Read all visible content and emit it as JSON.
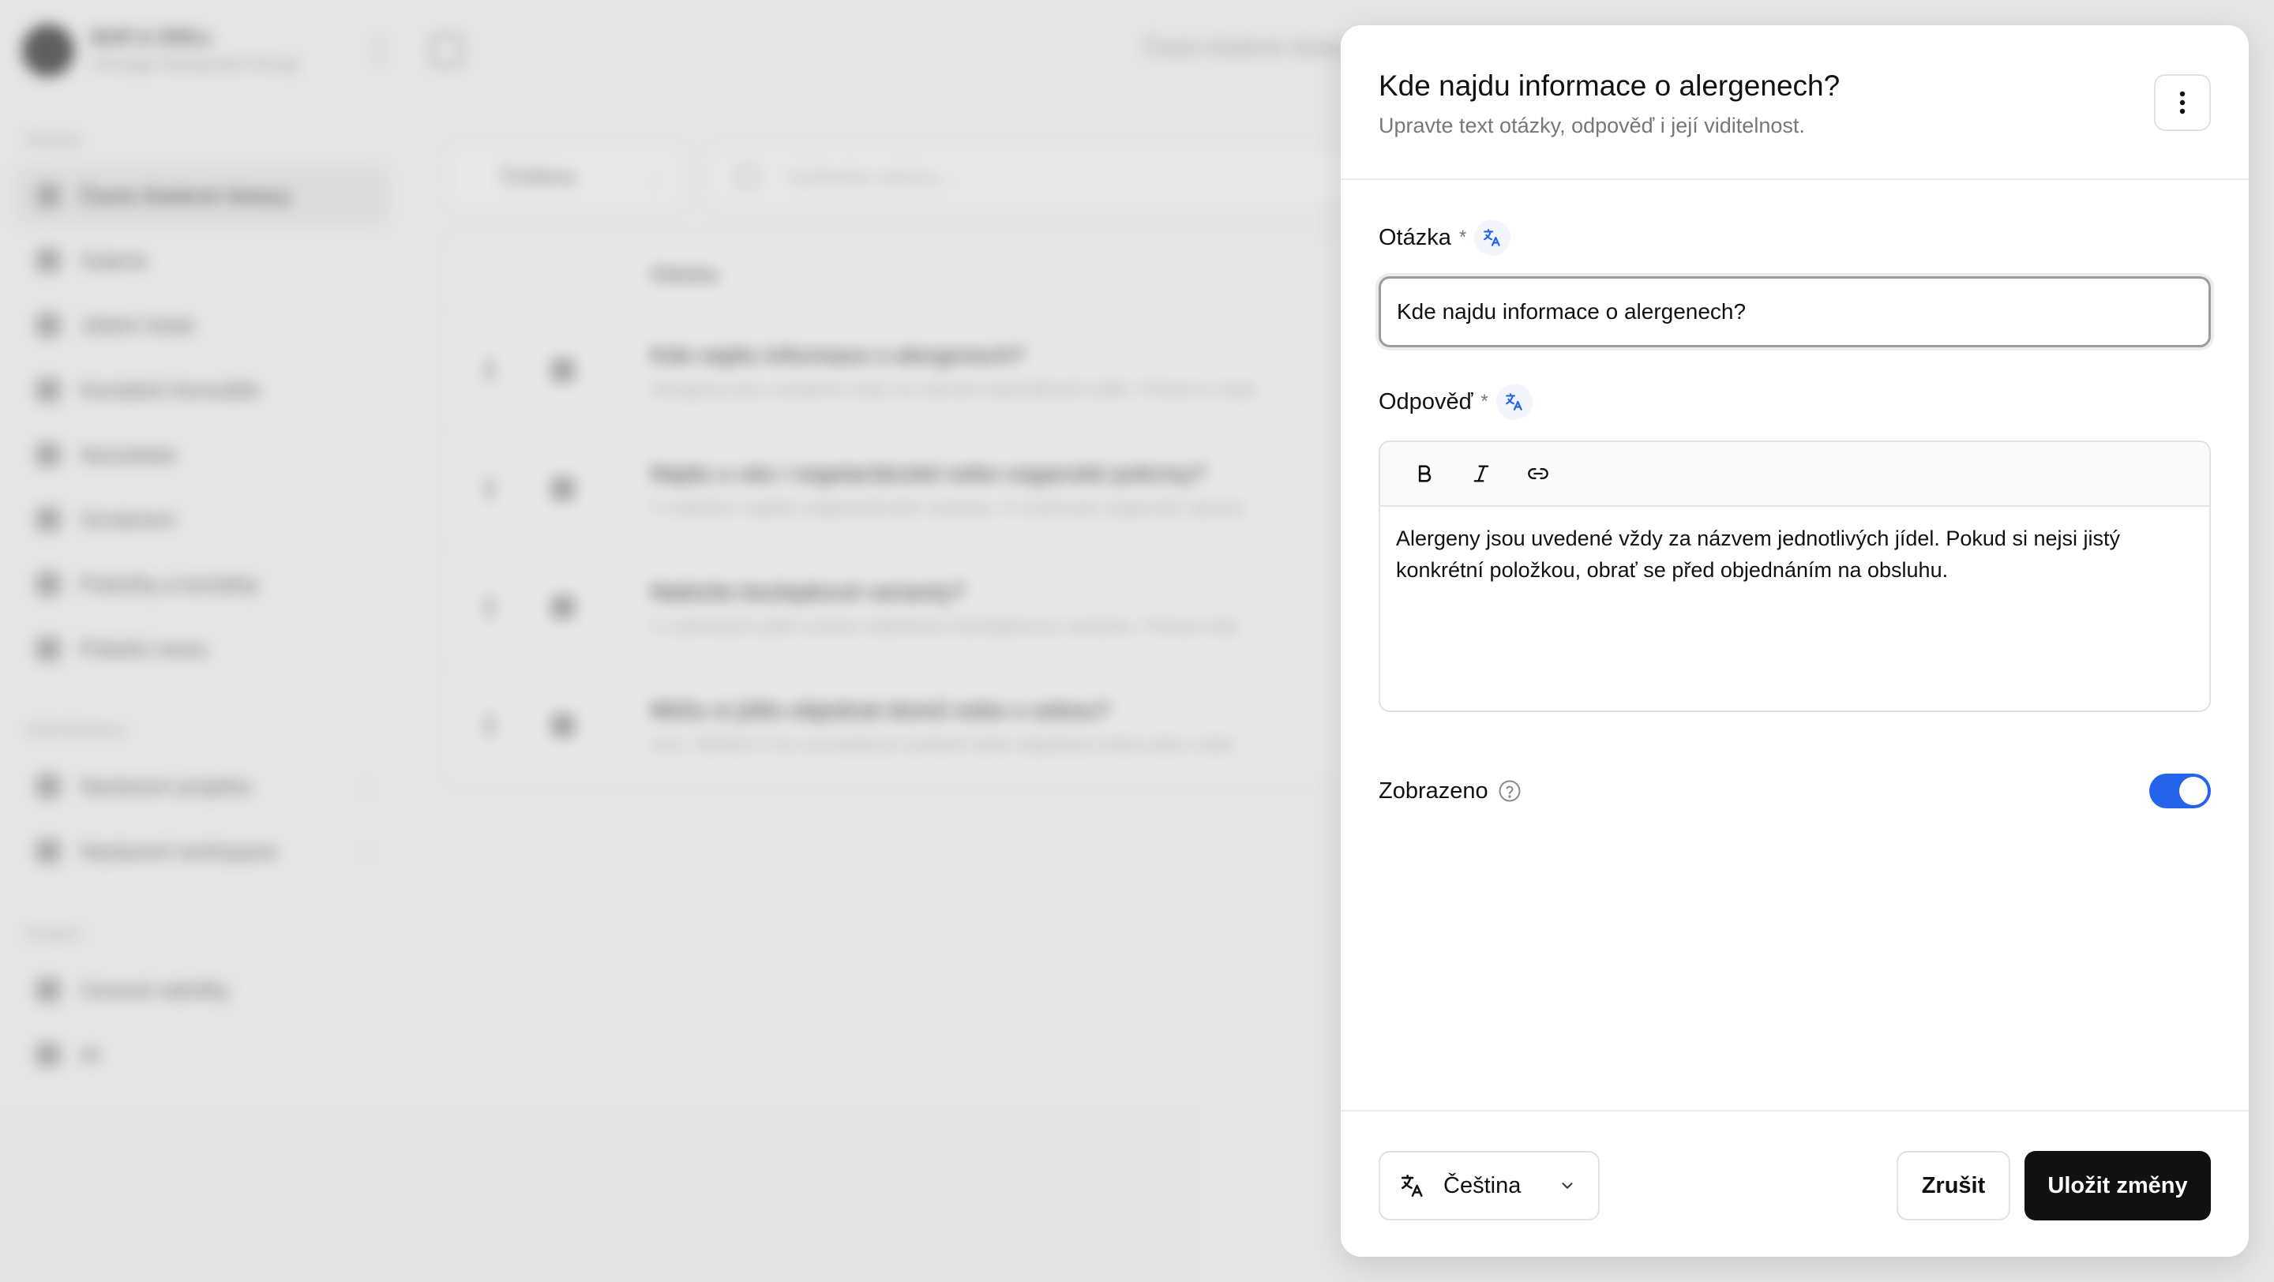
{
  "background": {
    "workspace": {
      "name": "BAR & GRILL",
      "subtitle": "Chicago Restaurant Group"
    },
    "sections": {
      "module": "Moduly",
      "admin": "Administrace",
      "other": "Ostatní"
    },
    "sidebar_items": [
      {
        "label": "Často kladené dotazy"
      },
      {
        "label": "Galerie"
      },
      {
        "label": "Jídelní lístek"
      },
      {
        "label": "Kontaktní formuláře"
      },
      {
        "label": "Newsletter"
      },
      {
        "label": "Oznámení"
      },
      {
        "label": "Pobočky a kontakty"
      },
      {
        "label": "Polední menu"
      },
      {
        "label": "Nastavení projektu"
      },
      {
        "label": "Nastavení workspace"
      },
      {
        "label": "Cenové nabídky"
      },
      {
        "label": "AI"
      }
    ],
    "page_title": "Často kladené dotazy",
    "filter_language": "Čeština",
    "search_placeholder": "Vyhledat otázku...",
    "table_header": "Otázka",
    "rows": [
      {
        "question": "Kde najdu informace o alergenech?",
        "answer": "Alergeny jsou uvedené vždy za názvem jednotlivých jídel. Pokud si nejsi"
      },
      {
        "question": "Najdu u vás i vegetariánské nebo veganské pokrmy?",
        "answer": "V nabídce najdeš vegetariánské varianty. O možnosti veganské úpravy"
      },
      {
        "question": "Nabízíte bezlepkové varianty?",
        "answer": "U vybraných jídel umíme nabídnout bezlepkovou variantu. Pokud máš"
      },
      {
        "question": "Můžu si jídlo objednat domů nebo s sebou?",
        "answer": "Ano. Můžeš si ho vyzvednout osobně nebo objednat online přes naše"
      }
    ]
  },
  "panel": {
    "title": "Kde najdu informace o alergenech?",
    "description": "Upravte text otázky, odpověď i její viditelnost.",
    "question_label": "Otázka",
    "required_mark": "*",
    "question_value": "Kde najdu informace o alergenech?",
    "answer_label": "Odpověď",
    "answer_value": "Alergeny jsou uvedené vždy za názvem jednotlivých jídel. Pokud si nejsi jistý konkrétní položkou, obrať se před objednáním na obsluhu.",
    "shown_label": "Zobrazeno",
    "shown_value": true,
    "language": "Čeština",
    "cancel_label": "Zrušit",
    "save_label": "Uložit změny"
  },
  "colors": {
    "accent": "#2563eb",
    "primary_button": "#111111",
    "toggle_on": "#2563eb"
  },
  "icons": [
    "more-vertical-icon",
    "translate-icon",
    "bold-icon",
    "italic-icon",
    "link-icon",
    "help-circle-icon",
    "chevron-down-icon"
  ]
}
